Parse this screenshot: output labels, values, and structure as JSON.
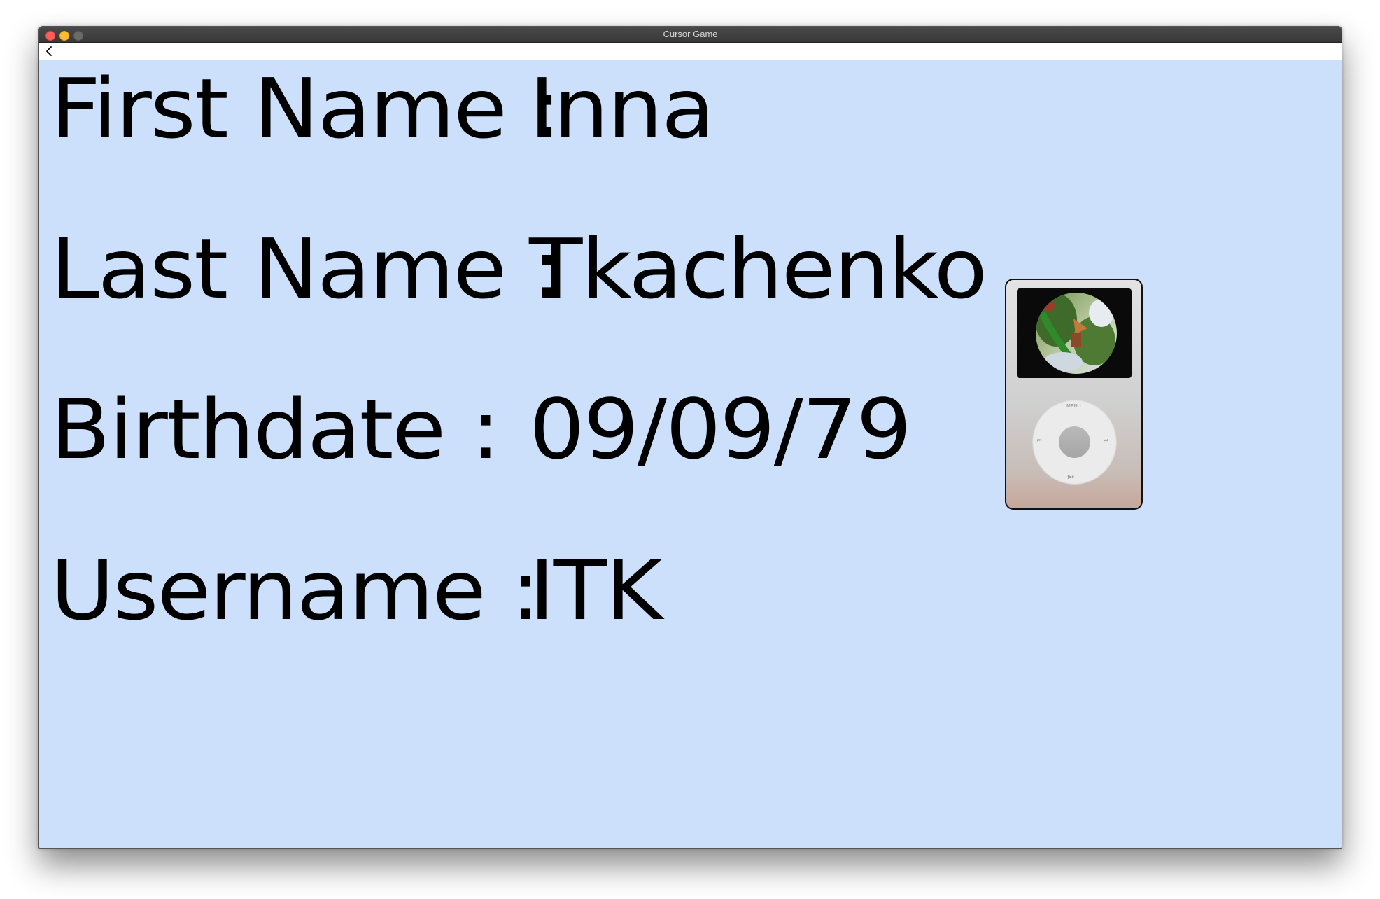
{
  "window": {
    "title": "Cursor Game"
  },
  "toolbar": {
    "back_icon": "chevron-left-icon"
  },
  "profile": {
    "rows": [
      {
        "label": "First Name :",
        "value": "Inna"
      },
      {
        "label": "Last Name :",
        "value": "Tkachenko"
      },
      {
        "label": "Birthdate :",
        "value": "09/09/79"
      },
      {
        "label": "Username :",
        "value": "ITK"
      }
    ]
  },
  "avatar": {
    "icon": "ipod-icon",
    "wheel_labels": {
      "menu": "MENU",
      "prev": "⏮",
      "next": "⏭",
      "play": "▶⏸"
    }
  },
  "colors": {
    "background": "#cce0fc",
    "text": "#000000"
  }
}
